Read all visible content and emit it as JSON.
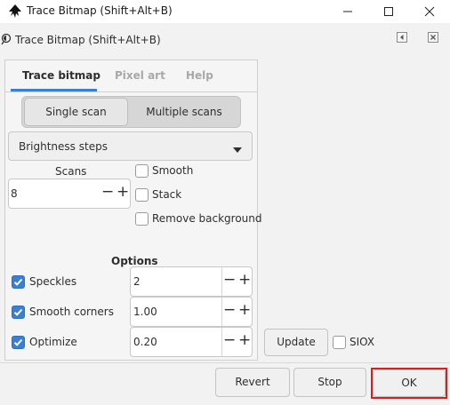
{
  "window": {
    "title": "Trace Bitmap (Shift+Alt+B)"
  },
  "dock": {
    "title": "Trace Bitmap (Shift+Alt+B)"
  },
  "tabs": [
    {
      "label": "Trace bitmap",
      "active": true
    },
    {
      "label": "Pixel art",
      "active": false
    },
    {
      "label": "Help",
      "active": false
    }
  ],
  "mode": {
    "single_label": "Single scan",
    "multiple_label": "Multiple scans",
    "selected": "Multiple scans"
  },
  "method": {
    "selected": "Brightness steps"
  },
  "scans": {
    "label": "Scans",
    "value": "8"
  },
  "multi_options": [
    {
      "label": "Smooth",
      "checked": false
    },
    {
      "label": "Stack",
      "checked": false
    },
    {
      "label": "Remove background",
      "checked": false
    }
  ],
  "options": {
    "title": "Options",
    "rows": [
      {
        "label": "Speckles",
        "checked": true,
        "value": "2"
      },
      {
        "label": "Smooth corners",
        "checked": true,
        "value": "1.00"
      },
      {
        "label": "Optimize",
        "checked": true,
        "value": "0.20"
      }
    ]
  },
  "preview": {
    "update_label": "Update",
    "siox_label": "SIOX",
    "siox_checked": false
  },
  "actions": {
    "revert_label": "Revert",
    "stop_label": "Stop",
    "ok_label": "OK"
  },
  "colors": {
    "accent": "#3b7fd4",
    "highlight_outline": "#d32020"
  },
  "icons": {
    "app": "inkscape-icon",
    "dock": "trace-bitmap-icon",
    "minimize": "minimize-icon",
    "maximize": "maximize-icon",
    "close": "close-icon",
    "dock_collapse": "dock-collapse-icon",
    "dock_close": "dock-close-icon",
    "dropdown": "chevron-down-icon",
    "check": "check-icon"
  }
}
